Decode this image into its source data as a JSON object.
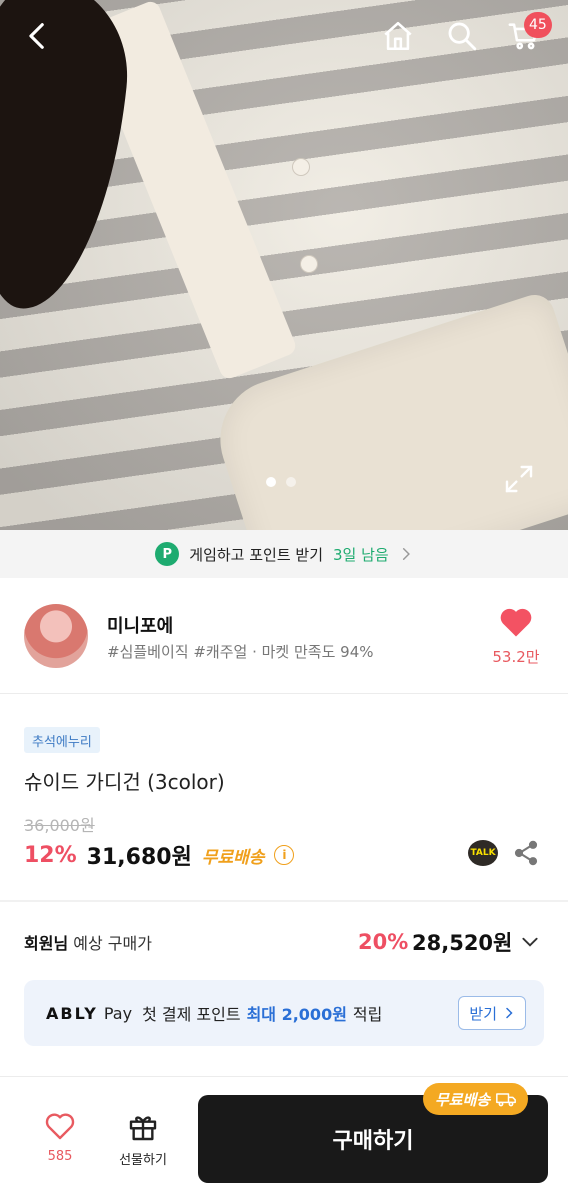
{
  "header": {
    "cart_count": "45"
  },
  "icons": {
    "back": "back-arrow-icon",
    "home": "home-icon",
    "search": "search-icon",
    "cart": "cart-icon",
    "expand": "expand-icon"
  },
  "carousel": {
    "current": 1,
    "total": 2
  },
  "game_banner": {
    "badge": "P",
    "text": "게임하고 포인트 받기",
    "days_left": "3일 남음"
  },
  "store": {
    "name": "미니포에",
    "tags": "#심플베이직 #캐주얼 · 마켓 만족도 94%",
    "likes": "53.2만"
  },
  "product": {
    "promo_tag": "추석에누리",
    "title": "슈이드 가디건 (3color)",
    "original_price": "36,000원",
    "discount": "12%",
    "price": "31,680원",
    "shipping": "무료배송",
    "info_icon": "i",
    "talk_label": "TALK"
  },
  "member": {
    "label_bold": "회원님",
    "label_rest": " 예상 구매가",
    "discount": "20%",
    "price": "28,520원"
  },
  "pay_banner": {
    "brand": "ABLY",
    "pay": "Pay",
    "text_before": "첫 결제 포인트",
    "max_text": "최대 2,000원",
    "text_after": "적립",
    "button": "받기"
  },
  "bottom_bar": {
    "fav_count": "585",
    "gift_label": "선물하기",
    "buy_label": "구매하기",
    "free_ship_pill": "무료배송"
  },
  "colors": {
    "accent_red": "#ee4f63",
    "game_green": "#1eab70",
    "ship_orange": "#f0a01c",
    "pay_blue": "#2a6fd6"
  }
}
